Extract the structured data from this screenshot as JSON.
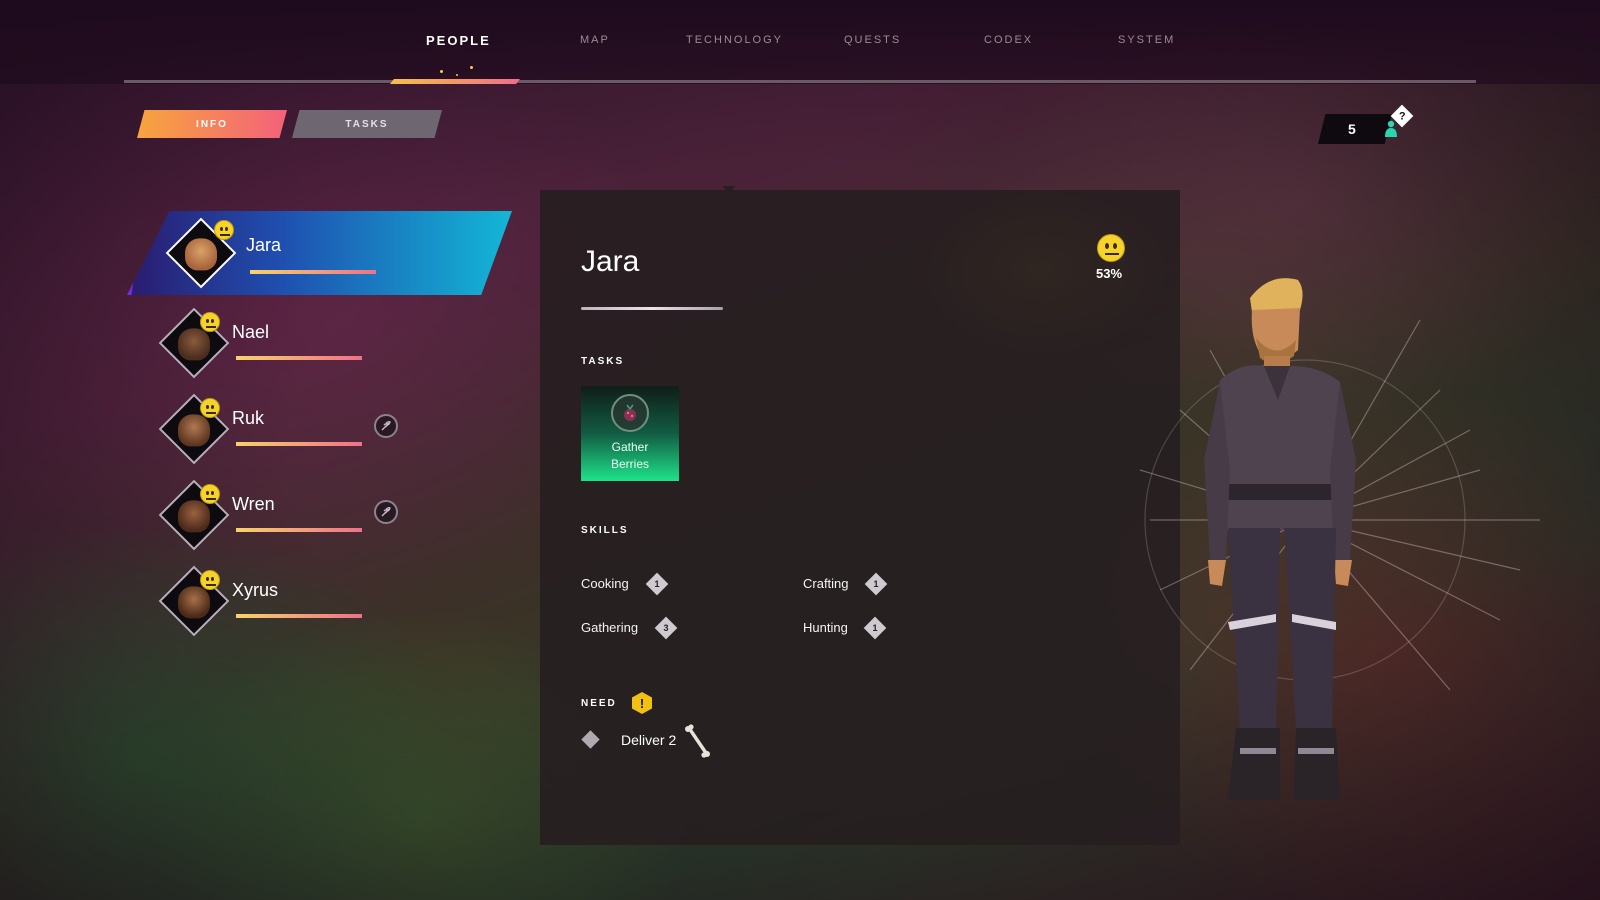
{
  "nav": {
    "tabs": [
      {
        "label": "PEOPLE"
      },
      {
        "label": "MAP"
      },
      {
        "label": "TECHNOLOGY"
      },
      {
        "label": "QUESTS"
      },
      {
        "label": "CODEX"
      },
      {
        "label": "SYSTEM"
      }
    ]
  },
  "subtabs": {
    "info": "INFO",
    "tasks": "TASKS"
  },
  "population": {
    "count": "5",
    "help": "?"
  },
  "villagers": [
    {
      "name": "Jara",
      "selected": true,
      "mood": "neutral",
      "status_icon": null
    },
    {
      "name": "Nael",
      "selected": false,
      "mood": "neutral",
      "status_icon": null
    },
    {
      "name": "Ruk",
      "selected": false,
      "mood": "neutral",
      "status_icon": "wheat-icon"
    },
    {
      "name": "Wren",
      "selected": false,
      "mood": "neutral",
      "status_icon": "wheat-icon"
    },
    {
      "name": "Xyrus",
      "selected": false,
      "mood": "neutral",
      "status_icon": null
    }
  ],
  "detail": {
    "name": "Jara",
    "mood_percent": "53%",
    "tasks_label": "TASKS",
    "task": {
      "line1": "Gather",
      "line2": "Berries",
      "icon": "berry-icon"
    },
    "skills_label": "SKILLS",
    "skills": [
      {
        "name": "Cooking",
        "level": "1"
      },
      {
        "name": "Crafting",
        "level": "1"
      },
      {
        "name": "Gathering",
        "level": "3"
      },
      {
        "name": "Hunting",
        "level": "1"
      }
    ],
    "need_label": "NEED",
    "need_alert": "!",
    "need_text": "Deliver 2",
    "need_item_icon": "bone-icon"
  },
  "colors": {
    "accent_warm": "#f7a53d",
    "accent_pink": "#f3617a",
    "selection_cyan": "#13b7d6",
    "task_green": "#1ee38a",
    "mood_yellow": "#f7d22b"
  }
}
